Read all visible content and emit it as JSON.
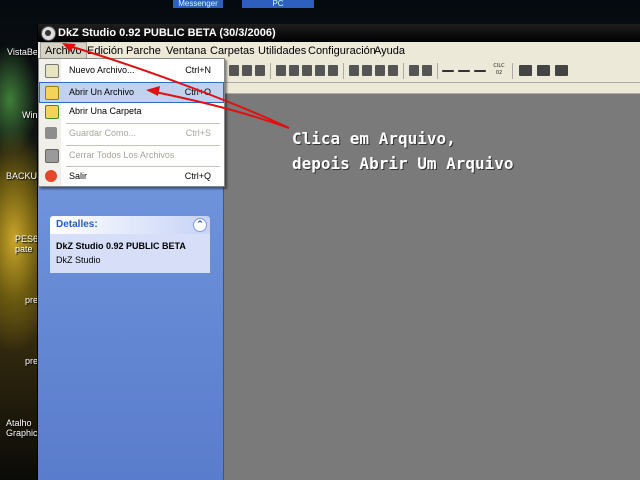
{
  "desktop": {
    "top_tabs": [
      "Messenger",
      "PC"
    ],
    "icons": [
      "VistaBe",
      "Win",
      "BACKUP",
      "PES6 pate",
      "pre",
      "pre",
      "Atalho Graphic"
    ]
  },
  "window": {
    "title": "DkZ Studio 0.92 PUBLIC BETA (30/3/2006)"
  },
  "menubar": {
    "items": [
      "Archivo",
      "Edición",
      "Parche",
      "Ventana",
      "Carpetas",
      "Utilidades",
      "Configuración",
      "Ayuda"
    ]
  },
  "file_menu": {
    "items": [
      {
        "label": "Nuevo Archivo...",
        "shortcut": "Ctrl+N",
        "enabled": true,
        "icon": "new-file-icon"
      },
      {
        "label": "Abrir Un Archivo",
        "shortcut": "Ctrl+O",
        "enabled": true,
        "icon": "open-file-icon",
        "highlighted": true
      },
      {
        "label": "Abrir Una Carpeta",
        "shortcut": "",
        "enabled": true,
        "icon": "open-folder-icon"
      },
      {
        "label": "Guardar Como...",
        "shortcut": "Ctrl+S",
        "enabled": false,
        "icon": "save-icon"
      },
      {
        "label": "Cerrar Todos Los Archivos",
        "shortcut": "",
        "enabled": false,
        "icon": "close-all-icon"
      },
      {
        "label": "Salir",
        "shortcut": "Ctrl+Q",
        "enabled": true,
        "icon": "exit-icon"
      }
    ]
  },
  "toolbar": {
    "calc_label": "CILC 02"
  },
  "details_panel": {
    "header": "Detalles:",
    "name": "DkZ Studio 0.92 PUBLIC BETA",
    "subtitle": "DkZ Studio"
  },
  "annotation": {
    "line1": "Clica em Arquivo,",
    "line2": "depois Abrir Um Arquivo",
    "arrow_color": "#e01010"
  },
  "colors": {
    "titlebar": "#000000",
    "taskpane": "#6b8fd8",
    "workspace": "#7a7a7a",
    "menu_highlight": "#c1d2ee"
  }
}
